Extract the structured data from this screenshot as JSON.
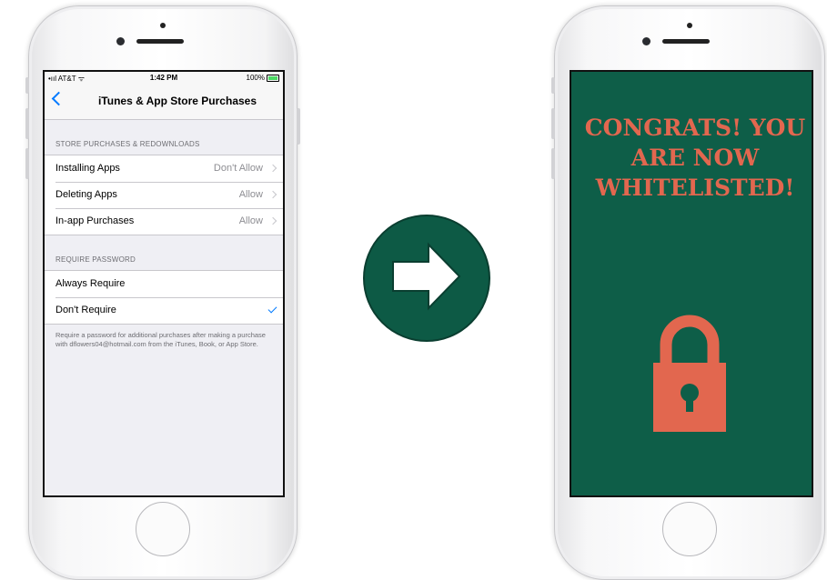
{
  "left_phone": {
    "status_bar": {
      "carrier": "•ııl AT&T ᯤ",
      "time": "1:42 PM",
      "battery": "100%"
    },
    "nav": {
      "title": "iTunes & App Store Purchases"
    },
    "section1": {
      "header": "STORE PURCHASES & REDOWNLOADS",
      "rows": [
        {
          "label": "Installing Apps",
          "value": "Don't Allow"
        },
        {
          "label": "Deleting Apps",
          "value": "Allow"
        },
        {
          "label": "In-app Purchases",
          "value": "Allow"
        }
      ]
    },
    "section2": {
      "header": "REQUIRE PASSWORD",
      "rows": [
        {
          "label": "Always Require",
          "checked": false
        },
        {
          "label": "Don't Require",
          "checked": true
        }
      ],
      "footer": "Require a password for additional purchases after making a purchase with dflowers04@hotmail.com from the iTunes, Book, or App Store."
    },
    "accent_color": "#007aff"
  },
  "arrow": {
    "icon": "right-arrow-icon",
    "color": "#0d5a45"
  },
  "right_phone": {
    "message": "CONGRATS! YOU ARE NOW WHITELISTED!",
    "icon": "lock-icon",
    "background_color": "#0e5e48",
    "accent_color": "#e2674f"
  }
}
